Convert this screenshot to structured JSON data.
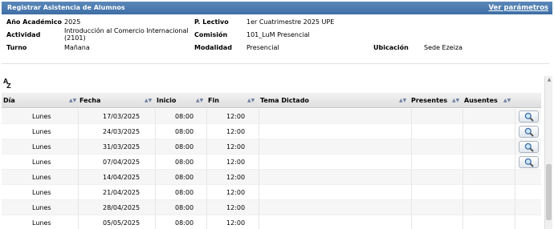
{
  "titlebar": {
    "title": "Registrar Asistencia de Alumnos",
    "link": "Ver parámetros"
  },
  "info": {
    "anio_label": "Año Académico",
    "anio_value": "2025",
    "periodo_label": "P. Lectivo",
    "periodo_value": "1er Cuatrimestre 2025 UPE",
    "actividad_label": "Actividad",
    "actividad_value_1": "Introducción al Comercio Internacional",
    "actividad_value_2": "(2101)",
    "comision_label": "Comisión",
    "comision_value": "101_LuM Presencial",
    "turno_label": "Turno",
    "turno_value": "Mañana",
    "modalidad_label": "Modalidad",
    "modalidad_value": "Presencial",
    "ubicacion_label": "Ubicación",
    "ubicacion_value": "Sede Ezeiza"
  },
  "sort_icon": "az-sort-icon",
  "table": {
    "columns": [
      "Día",
      "Fecha",
      "Inicio",
      "Fin",
      "Tema Dictado",
      "Presentes",
      "Ausentes"
    ],
    "rows": [
      {
        "dia": "Lunes",
        "fecha": "17/03/2025",
        "inicio": "08:00",
        "fin": "12:00",
        "button": true
      },
      {
        "dia": "Lunes",
        "fecha": "24/03/2025",
        "inicio": "08:00",
        "fin": "12:00",
        "button": true
      },
      {
        "dia": "Lunes",
        "fecha": "31/03/2025",
        "inicio": "08:00",
        "fin": "12:00",
        "button": true
      },
      {
        "dia": "Lunes",
        "fecha": "07/04/2025",
        "inicio": "08:00",
        "fin": "12:00",
        "button": true
      },
      {
        "dia": "Lunes",
        "fecha": "14/04/2025",
        "inicio": "08:00",
        "fin": "12:00",
        "button": false
      },
      {
        "dia": "Lunes",
        "fecha": "21/04/2025",
        "inicio": "08:00",
        "fin": "12:00",
        "button": false
      },
      {
        "dia": "Lunes",
        "fecha": "28/04/2025",
        "inicio": "08:00",
        "fin": "12:00",
        "button": false
      },
      {
        "dia": "Lunes",
        "fecha": "05/05/2025",
        "inicio": "08:00",
        "fin": "12:00",
        "button": false
      }
    ]
  },
  "colors": {
    "titlebar": "#4a7ab0",
    "header_bg": "#e8e8e8",
    "row_alt": "#f6f6f6"
  }
}
